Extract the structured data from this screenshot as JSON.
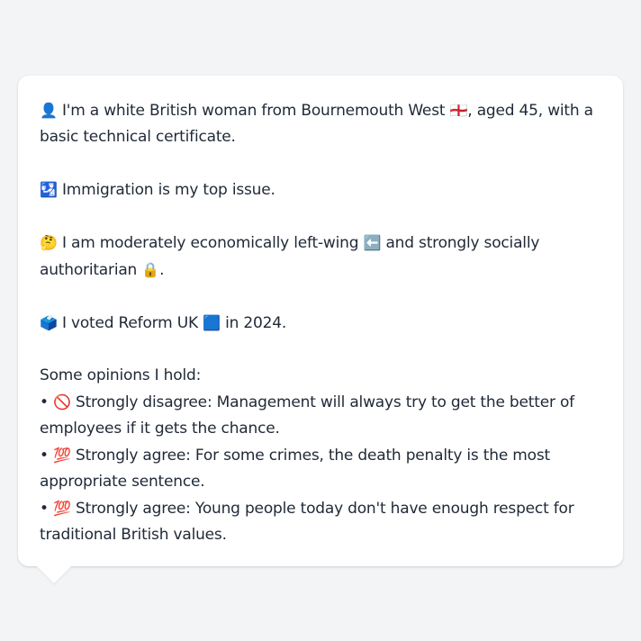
{
  "message": {
    "intro": {
      "icon": "👤",
      "text": "I'm a white British woman from Bournemouth West",
      "flag": "🏴󠁧󠁢󠁥󠁮󠁧󠁿",
      "text_after": ", aged 45, with a basic technical certificate."
    },
    "issue": {
      "icon": "🛂",
      "text": "Immigration is my top issue."
    },
    "ideology": {
      "icon": "🤔",
      "text_before": "I am moderately economically left-wing",
      "left_icon": "⬅️",
      "text_middle": "and strongly socially authoritarian",
      "lock_icon": "🔒",
      "text_end": "."
    },
    "vote": {
      "icon": "🗳️",
      "text_before": "I voted Reform UK",
      "square_icon": "🟦",
      "text_after": "in 2024."
    },
    "opinions_heading": "Some opinions I hold:",
    "opinions": [
      {
        "bullet": "•",
        "icon": "🚫",
        "text": "Strongly disagree: Management will always try to get the better of employees if it gets the chance."
      },
      {
        "bullet": "•",
        "icon": "💯",
        "text": "Strongly agree: For some crimes, the death penalty is the most appropriate sentence."
      },
      {
        "bullet": "•",
        "icon": "💯",
        "text": "Strongly agree: Young people today don't have enough respect for traditional British values."
      }
    ]
  }
}
